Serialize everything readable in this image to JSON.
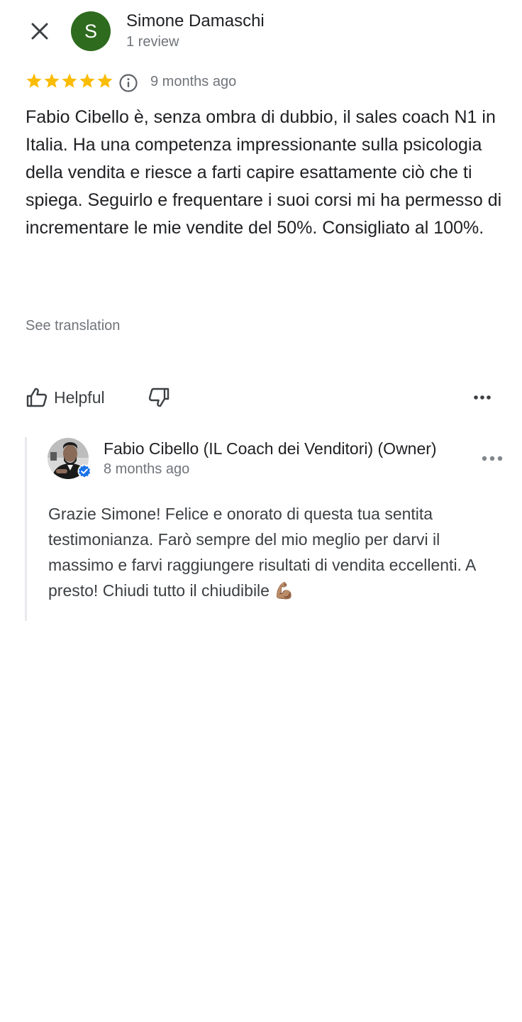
{
  "header": {
    "close_icon": "close-icon",
    "avatar_initial": "S",
    "avatar_color": "#2e6b1e",
    "reviewer_name": "Simone Damaschi",
    "review_count": "1 review"
  },
  "rating": {
    "stars": 5,
    "max_stars": 5,
    "star_color": "#fbbc04",
    "info_icon": "info-icon",
    "date": "9 months ago"
  },
  "review": {
    "text": "Fabio Cibello è, senza ombra di dubbio, il sales coach N1 in Italia. Ha una competenza impressionante sulla psicologia della vendita e riesce a farti capire esattamente ciò che ti spiega. Seguirlo e frequentare i suoi corsi mi ha permesso di incrementare le mie vendite del 50%. Consigliato al 100%.",
    "see_translation": "See translation"
  },
  "actions": {
    "helpful_label": "Helpful",
    "like_icon": "thumbs-up-icon",
    "dislike_icon": "thumbs-down-icon",
    "more_icon": "more-horizontal-icon"
  },
  "owner_reply": {
    "owner_name": "Fabio Cibello (IL Coach dei Venditori) (Owner)",
    "verified_icon": "verified-badge-icon",
    "date": "8 months ago",
    "text": "Grazie Simone! Felice e onorato di questa tua sentita testimonianza. Farò sempre del mio meglio per darvi il massimo e farvi raggiungere risultati di vendita eccellenti. A presto! Chiudi tutto il chiudibile 💪🏽",
    "more_icon": "more-horizontal-icon"
  }
}
